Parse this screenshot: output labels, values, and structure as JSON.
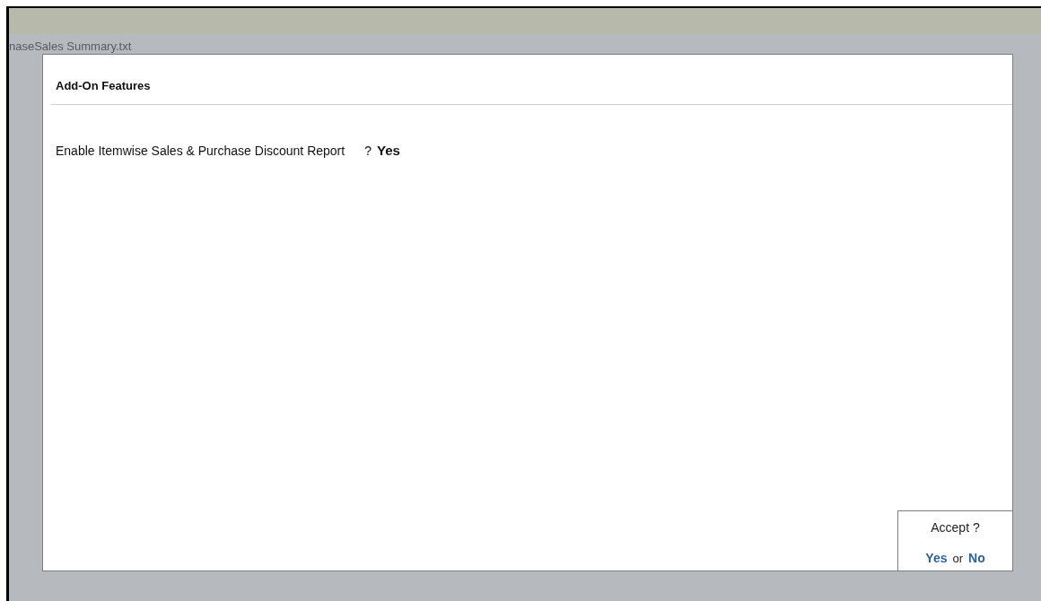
{
  "background_file": "naseSales Summary.txt",
  "dialog": {
    "title": "Add-On Features",
    "fields": [
      {
        "label": "Enable Itemwise Sales & Purchase Discount Report",
        "separator": "?",
        "value": "Yes"
      }
    ]
  },
  "accept_prompt": {
    "question": "Accept ?",
    "yes": "Yes",
    "joiner": "or",
    "no": "No"
  }
}
